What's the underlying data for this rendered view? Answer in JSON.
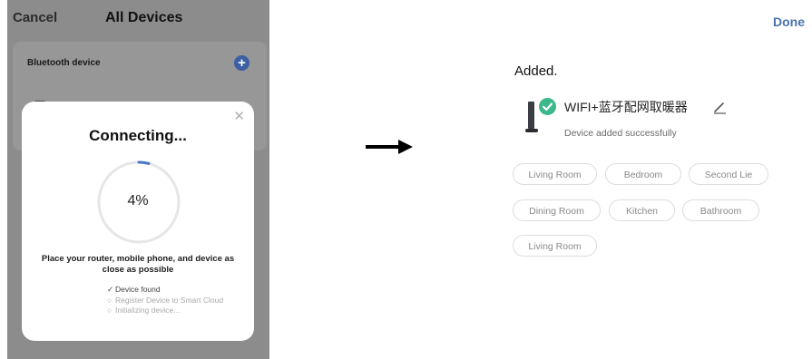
{
  "left_screen": {
    "cancel_label": "Cancel",
    "title": "All Devices",
    "bluetooth_label": "Bluetooth device",
    "modal": {
      "title": "Connecting...",
      "progress_percent_text": "4%",
      "progress_fraction": 0.04,
      "advice": "Place your router, mobile phone, and device as close as possible",
      "steps": [
        {
          "mark": "✓",
          "label": "Device found",
          "state": "done"
        },
        {
          "mark": "○",
          "label": "Register Device to Smart Cloud",
          "state": "pending"
        },
        {
          "mark": "○",
          "label": "Initializing device...",
          "state": "pending"
        }
      ]
    }
  },
  "right_screen": {
    "done_label": "Done",
    "heading": "Added.",
    "device_name": "WIFI+蓝牙配网取暖器",
    "device_status": "Device added successfully",
    "rooms": [
      "Living Room",
      "Bedroom",
      "Second Lie",
      "Dining Room",
      "Kitchen",
      "Bathroom",
      "Living Room"
    ]
  },
  "colors": {
    "accent_blue": "#4a72b0",
    "success_green": "#3cb88a",
    "ring_track": "#e6e6e6",
    "ring_progress": "#4a78c8"
  },
  "icons": [
    "plus-icon",
    "close-icon",
    "checkmark-icon",
    "circle-icon",
    "device-heater-icon",
    "check-badge-icon",
    "pencil-icon",
    "arrow-right-icon"
  ]
}
